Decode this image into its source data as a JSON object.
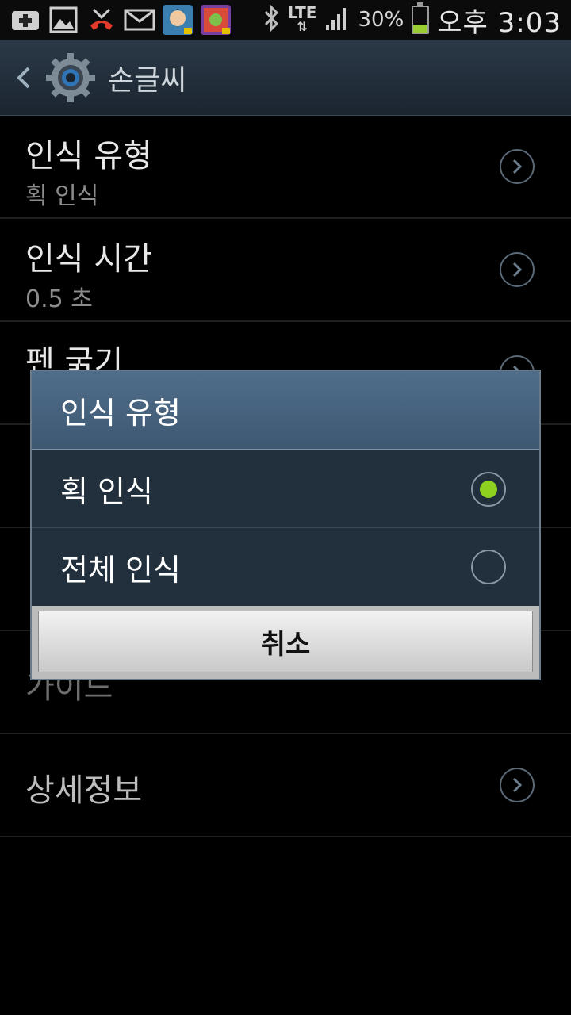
{
  "status_bar": {
    "battery_percent": "30%",
    "battery_level": 0.3,
    "network": "LTE",
    "time": "오후 3:03",
    "notification_icons": [
      "add-icon",
      "image-icon",
      "missed-call-icon",
      "mail-icon",
      "app-avatar-icon",
      "app-game-icon"
    ],
    "system_icons": [
      "bluetooth-icon",
      "lte-icon",
      "signal-icon",
      "battery-icon"
    ]
  },
  "action_bar": {
    "title": "손글씨",
    "icon": "gear-icon"
  },
  "settings": {
    "items": [
      {
        "title": "인식 유형",
        "subtitle": "획 인식"
      },
      {
        "title": "인식 시간",
        "subtitle": "0.5 초"
      },
      {
        "title": "펜 굵기",
        "subtitle": ""
      },
      {
        "title": "",
        "subtitle": ""
      },
      {
        "title": "",
        "subtitle": ""
      },
      {
        "title": "가이드",
        "subtitle": ""
      },
      {
        "title": "상세정보",
        "subtitle": ""
      }
    ]
  },
  "dialog": {
    "title": "인식 유형",
    "options": [
      {
        "label": "획 인식",
        "selected": true
      },
      {
        "label": "전체 인식",
        "selected": false
      }
    ],
    "cancel_label": "취소"
  },
  "colors": {
    "accent_radio": "#8ed11e",
    "dialog_title_bg": "#4f6d8a",
    "dialog_body_bg": "#22303d"
  }
}
